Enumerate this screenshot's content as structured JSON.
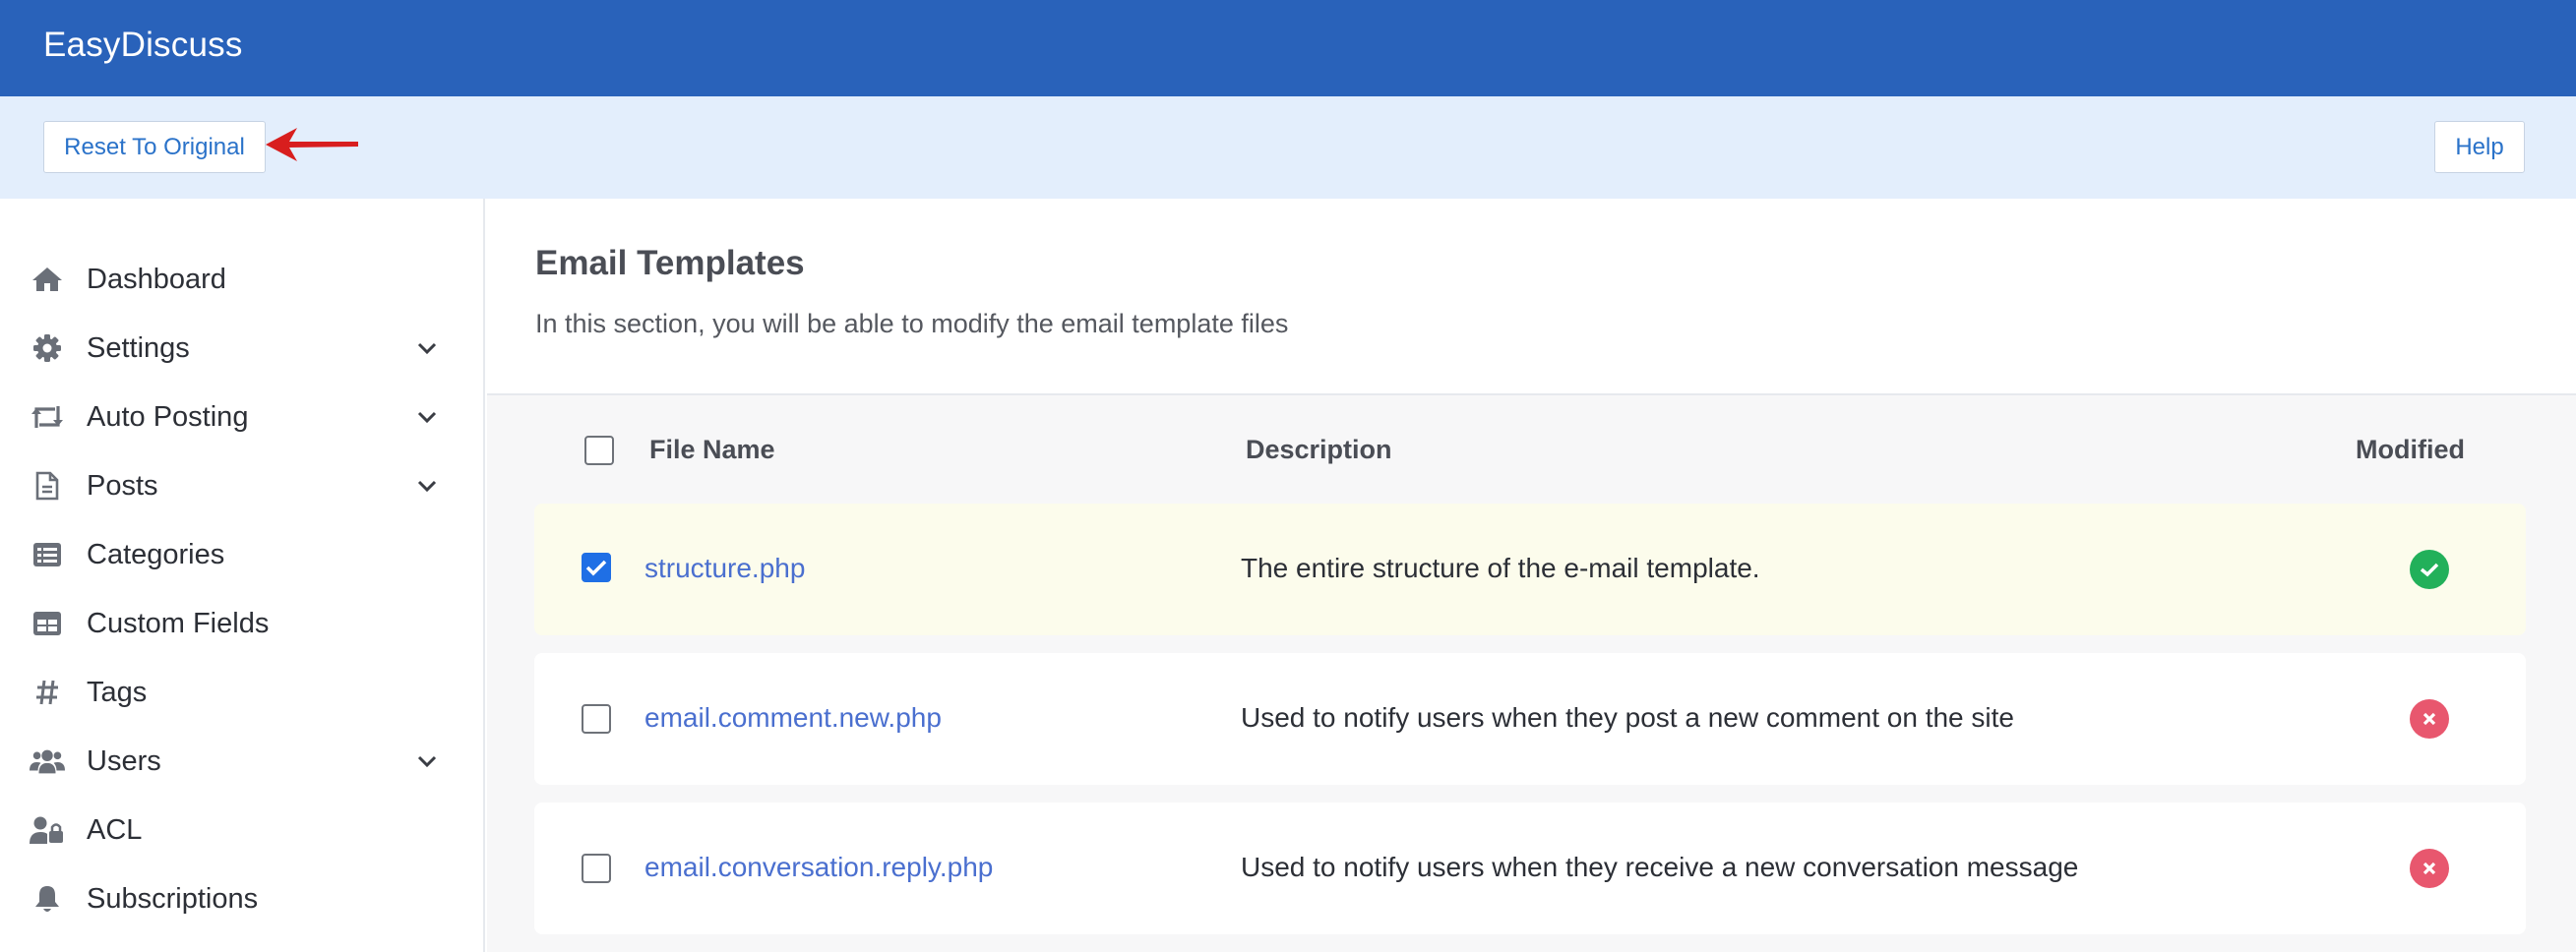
{
  "app": {
    "title": "EasyDiscuss"
  },
  "toolbar": {
    "reset_label": "Reset To Original",
    "help_label": "Help"
  },
  "sidebar": {
    "items": [
      {
        "label": "Dashboard",
        "icon": "home-icon",
        "has_children": false
      },
      {
        "label": "Settings",
        "icon": "gear-icon",
        "has_children": true
      },
      {
        "label": "Auto Posting",
        "icon": "retweet-icon",
        "has_children": true
      },
      {
        "label": "Posts",
        "icon": "file-icon",
        "has_children": true
      },
      {
        "label": "Categories",
        "icon": "list-icon",
        "has_children": false
      },
      {
        "label": "Custom Fields",
        "icon": "table-icon",
        "has_children": false
      },
      {
        "label": "Tags",
        "icon": "hashtag-icon",
        "has_children": false
      },
      {
        "label": "Users",
        "icon": "users-icon",
        "has_children": true
      },
      {
        "label": "ACL",
        "icon": "user-lock-icon",
        "has_children": false
      },
      {
        "label": "Subscriptions",
        "icon": "bell-icon",
        "has_children": false
      }
    ]
  },
  "main": {
    "title": "Email Templates",
    "description": "In this section, you will be able to modify the email template files",
    "table": {
      "columns": {
        "file_name": "File Name",
        "description": "Description",
        "modified": "Modified"
      },
      "rows": [
        {
          "file": "structure.php",
          "description": "The entire structure of the e-mail template.",
          "modified": true,
          "checked": true
        },
        {
          "file": "email.comment.new.php",
          "description": "Used to notify users when they post a new comment on the site",
          "modified": false,
          "checked": false
        },
        {
          "file": "email.conversation.reply.php",
          "description": "Used to notify users when they receive a new conversation message",
          "modified": false,
          "checked": false
        }
      ]
    }
  },
  "colors": {
    "topbar": "#2962ba",
    "actionbar": "#e3eefc",
    "link": "#4a6fcf",
    "ok": "#22b05a",
    "bad": "#e8576e",
    "annotation_arrow": "#d81e1e"
  }
}
